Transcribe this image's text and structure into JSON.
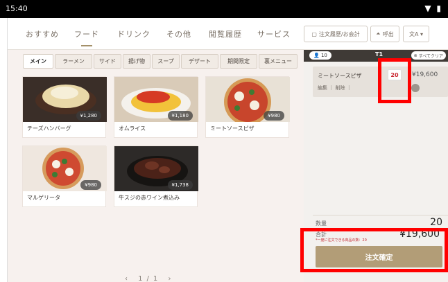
{
  "status_bar": {
    "time": "15:40",
    "icons": "▼ ▮"
  },
  "top_tabs": [
    {
      "label": "おすすめ"
    },
    {
      "label": "フード"
    },
    {
      "label": "ドリンク"
    },
    {
      "label": "その他"
    },
    {
      "label": "閲覧履歴"
    },
    {
      "label": "サービス"
    }
  ],
  "top_buttons": {
    "history": "注文履歴/お会計",
    "call": "呼出",
    "lang": "文A ▾"
  },
  "categories": [
    "メイン",
    "ラーメン",
    "サイド",
    "揚げ物",
    "スープ",
    "デザート",
    "期間限定",
    "裏メニュー"
  ],
  "menu_items": [
    {
      "name": "チーズハンバーグ",
      "price": "¥1,280"
    },
    {
      "name": "オムライス",
      "price": "¥1,180"
    },
    {
      "name": "ミートソースピザ",
      "price": "¥980"
    },
    {
      "name": "マルゲリータ",
      "price": "¥980"
    },
    {
      "name": "牛スジの赤ワイン煮込み",
      "price": "¥1,738"
    }
  ],
  "pager": {
    "text": "‹ 1/1 ›"
  },
  "order_panel": {
    "people": "10",
    "table": "T1",
    "clear": "すべてクリア",
    "item": {
      "name": "ミートソースピザ",
      "qty": "20",
      "price": "¥19,600",
      "edit": "編集 ｜ 削除 ｜"
    },
    "qty_label": "数量",
    "qty_value": "20",
    "total_label": "合計",
    "total_value": "¥19,600",
    "note": "*一度に注文できる商品の数：20",
    "confirm": "注文確定"
  },
  "highlight_colors": {
    "red": "#ff0000",
    "gold": "#b29d77"
  }
}
